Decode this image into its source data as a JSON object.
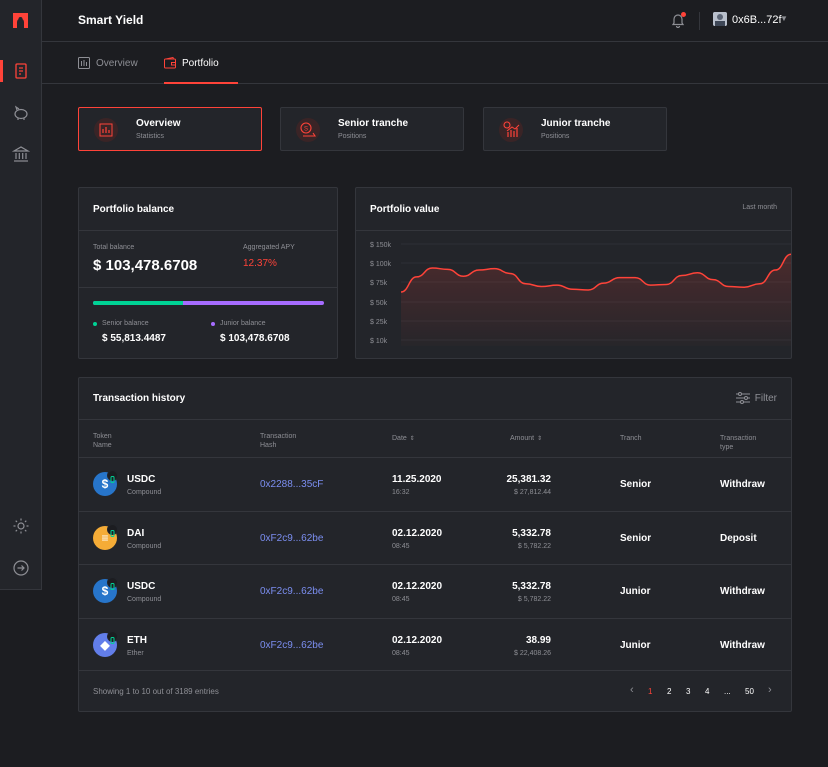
{
  "header": {
    "title": "Smart Yield",
    "wallet": "0x6B...72f"
  },
  "tabs": [
    {
      "label": "Overview"
    },
    {
      "label": "Portfolio"
    }
  ],
  "stat_cards": [
    {
      "title": "Overview",
      "subtitle": "Statistics"
    },
    {
      "title": "Senior tranche",
      "subtitle": "Positions"
    },
    {
      "title": "Junior tranche",
      "subtitle": "Positions"
    }
  ],
  "balance": {
    "title": "Portfolio balance",
    "total_label": "Total balance",
    "total_value": "$ 103,478.6708",
    "apy_label": "Aggregated APY",
    "apy_value": "12.37%",
    "senior_fraction": 0.39,
    "senior_label": "Senior balance",
    "senior_value": "$ 55,813.4487",
    "junior_label": "Junior balance",
    "junior_value": "$ 103,478.6708",
    "senior_color": "#00d395",
    "junior_color": "#a66cff"
  },
  "portfolio_value": {
    "title": "Portfolio value",
    "range": "Last month"
  },
  "chart_data": {
    "type": "area",
    "title": "Portfolio value",
    "x": [
      0,
      0.04,
      0.08,
      0.12,
      0.16,
      0.2,
      0.24,
      0.28,
      0.32,
      0.36,
      0.4,
      0.44,
      0.48,
      0.52,
      0.56,
      0.6,
      0.64,
      0.68,
      0.72,
      0.76,
      0.8,
      0.84,
      0.88,
      0.92,
      0.96,
      1.0
    ],
    "series": [
      {
        "values": [
          80000,
          102000,
          115000,
          113000,
          103000,
          112000,
          114000,
          107000,
          92000,
          88000,
          90000,
          84000,
          83000,
          93000,
          101000,
          101000,
          90000,
          91000,
          104000,
          108000,
          98000,
          88000,
          87000,
          92000,
          112000,
          135000
        ]
      }
    ],
    "y_ticks": [
      "$ 150k",
      "$ 100k",
      "$ 75k",
      "$ 50k",
      "$ 25k",
      "$ 10k"
    ],
    "color": "#ff4339"
  },
  "transactions": {
    "title": "Transaction history",
    "filter_label": "Filter",
    "columns": {
      "token": [
        "Token",
        "Name"
      ],
      "hash": [
        "Transaction",
        "Hash"
      ],
      "date": "Date",
      "amount": "Amount",
      "tranche": "Tranch",
      "type": [
        "Transaction",
        "type"
      ]
    },
    "rows": [
      {
        "symbol": "USDC",
        "protocol": "Compound",
        "icon": "usdc-icon",
        "icon_color": "#2775ca",
        "hash": "0x2288...35cF",
        "date": "11.25.2020",
        "time": "16:32",
        "amount": "25,381.32",
        "usd": "$ 27,812.44",
        "tranche": "Senior",
        "type": "Withdraw"
      },
      {
        "symbol": "DAI",
        "protocol": "Compound",
        "icon": "dai-icon",
        "icon_color": "#f5ac37",
        "hash": "0xF2c9...62be",
        "date": "02.12.2020",
        "time": "08:45",
        "amount": "5,332.78",
        "usd": "$ 5,782.22",
        "tranche": "Senior",
        "type": "Deposit"
      },
      {
        "symbol": "USDC",
        "protocol": "Compound",
        "icon": "usdc-icon",
        "icon_color": "#2775ca",
        "hash": "0xF2c9...62be",
        "date": "02.12.2020",
        "time": "08:45",
        "amount": "5,332.78",
        "usd": "$ 5,782.22",
        "tranche": "Junior",
        "type": "Withdraw"
      },
      {
        "symbol": "ETH",
        "protocol": "Ether",
        "icon": "eth-icon",
        "icon_color": "#627eea",
        "hash": "0xF2c9...62be",
        "date": "02.12.2020",
        "time": "08:45",
        "amount": "38.99",
        "usd": "$ 22,408.26",
        "tranche": "Junior",
        "type": "Withdraw"
      }
    ],
    "footer": "Showing 1 to 10 out of 3189 entries",
    "pagination": [
      "1",
      "2",
      "3",
      "4",
      "...",
      "50"
    ],
    "current_page": "1"
  },
  "colors": {
    "accent": "#ff4339",
    "bg": "#1c1d21",
    "panel": "#23252a",
    "link": "#7b8ef0"
  }
}
